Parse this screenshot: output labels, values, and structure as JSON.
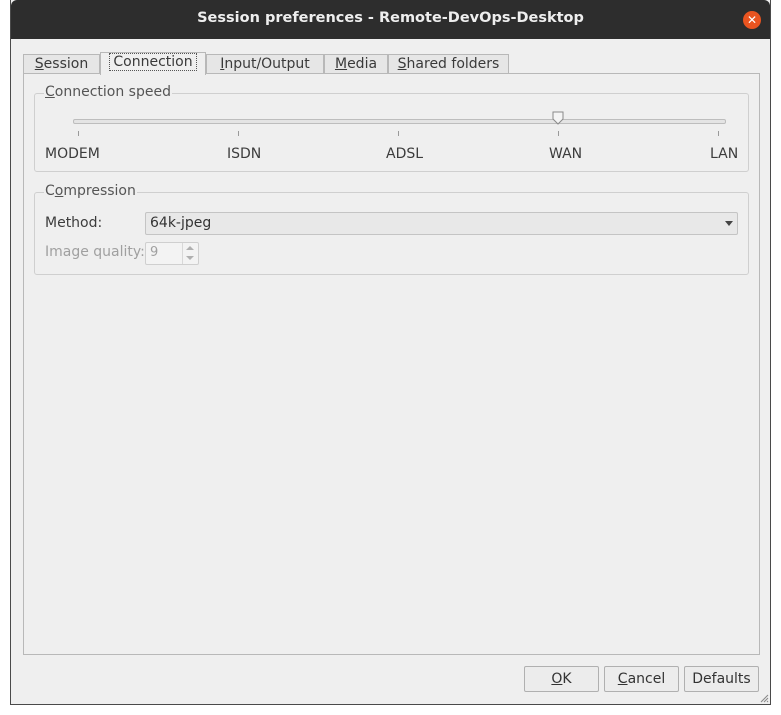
{
  "window": {
    "title": "Session preferences - Remote-DevOps-Desktop",
    "close_glyph": "✕"
  },
  "tabs": [
    {
      "label": "Session",
      "mnemonic": "S",
      "rest": "ession",
      "active": false
    },
    {
      "label": "Connection",
      "mnemonic": "",
      "rest": "Connection",
      "active": true
    },
    {
      "label": "Input/Output",
      "mnemonic": "I",
      "rest": "nput/Output",
      "active": false
    },
    {
      "label": "Media",
      "mnemonic": "M",
      "rest": "edia",
      "active": false
    },
    {
      "label": "Shared folders",
      "mnemonic": "S",
      "rest": "hared folders",
      "active": false
    }
  ],
  "connection_speed": {
    "title_mnemonic": "C",
    "title_rest": "onnection speed",
    "levels": [
      "MODEM",
      "ISDN",
      "ADSL",
      "WAN",
      "LAN"
    ],
    "selected": "WAN"
  },
  "compression": {
    "title_first": "C",
    "title_mnemonic": "o",
    "title_rest": "mpression",
    "method_label": "Method:",
    "method_value": "64k-jpeg",
    "image_quality_label": "Image quality:",
    "image_quality_value": "9"
  },
  "buttons": {
    "ok_mnemonic": "O",
    "ok_rest": "K",
    "cancel_mnemonic": "C",
    "cancel_rest": "ancel",
    "defaults": "Defaults"
  },
  "colors": {
    "titlebar": "#2d2d2d",
    "close": "#e95420",
    "window_bg": "#efefef"
  }
}
